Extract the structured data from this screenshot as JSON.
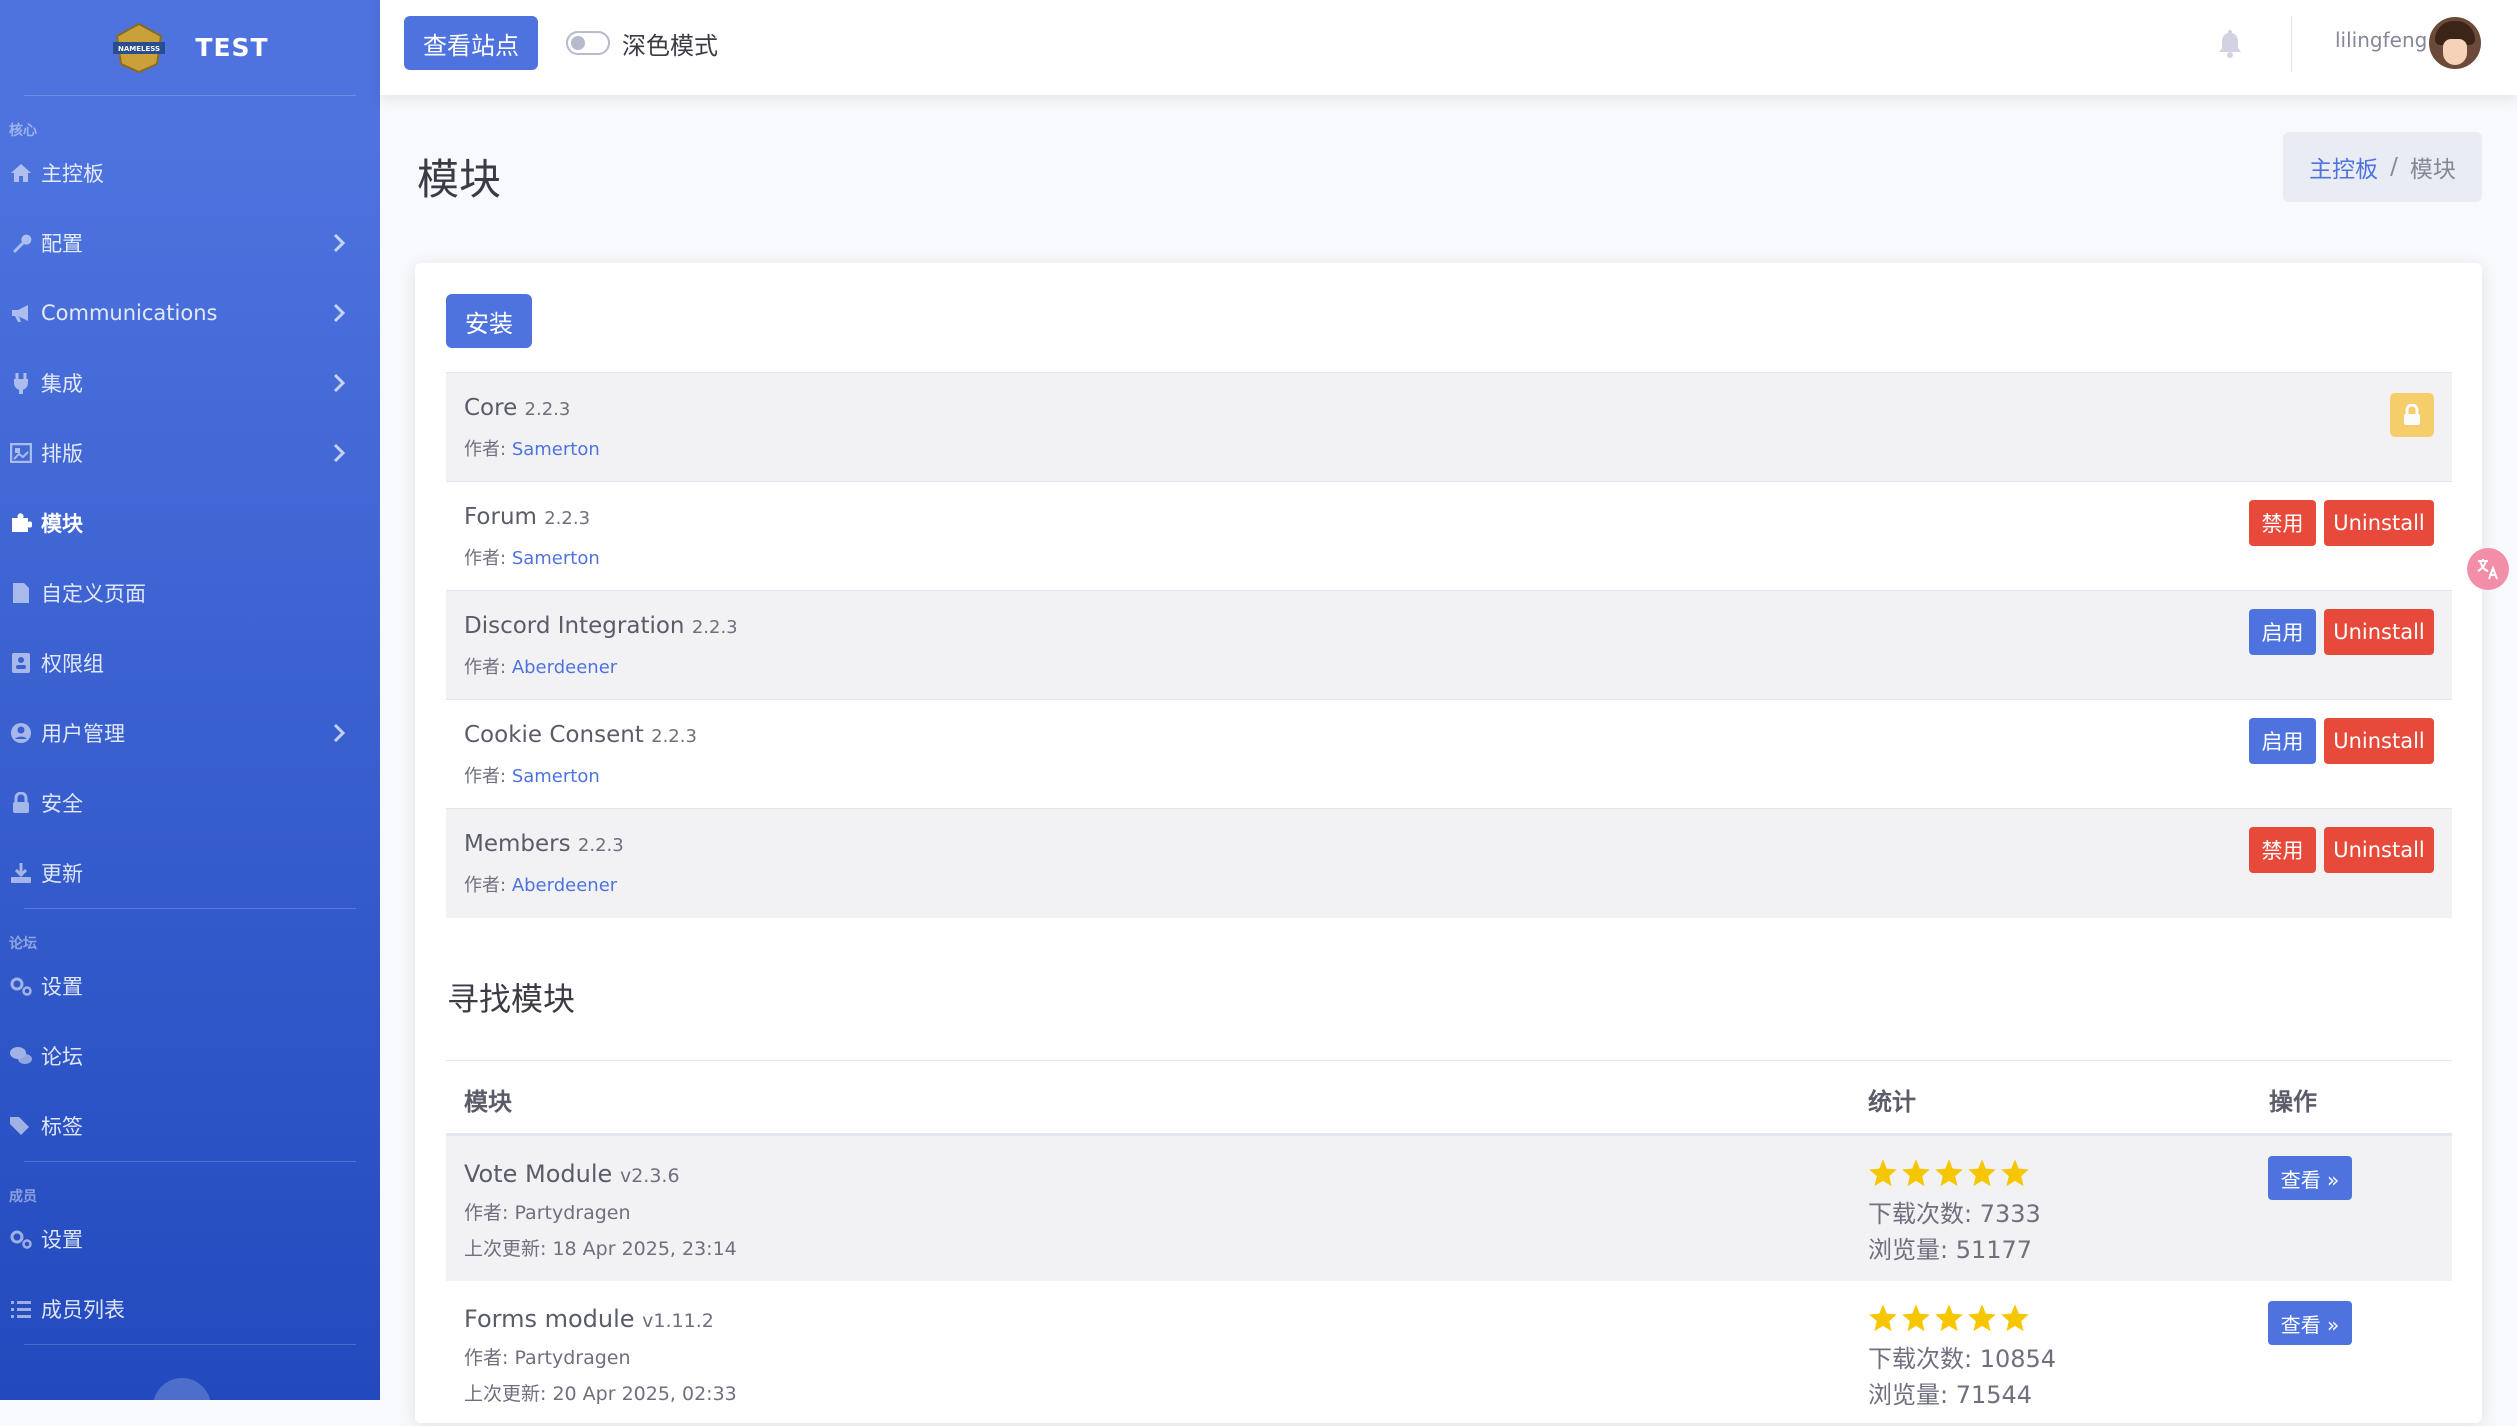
{
  "brand": {
    "title": "TEST",
    "logo_text": "NAMELESS"
  },
  "sidebar": {
    "heading_core": "核心",
    "heading_forum": "论坛",
    "heading_members": "成员",
    "items": [
      {
        "label": "主控板",
        "icon": "home-icon"
      },
      {
        "label": "配置",
        "icon": "wrench-icon"
      },
      {
        "label": "Communications",
        "icon": "megaphone-icon"
      },
      {
        "label": "集成",
        "icon": "plug-icon"
      },
      {
        "label": "排版",
        "icon": "layout-icon"
      },
      {
        "label": "模块",
        "icon": "puzzle-icon"
      },
      {
        "label": "自定义页面",
        "icon": "file-icon"
      },
      {
        "label": "权限组",
        "icon": "address-card-icon"
      },
      {
        "label": "用户管理",
        "icon": "user-circle-icon"
      },
      {
        "label": "安全",
        "icon": "lock-icon"
      },
      {
        "label": "更新",
        "icon": "download-icon"
      }
    ],
    "forum_items": [
      {
        "label": "设置",
        "icon": "cogs-icon"
      },
      {
        "label": "论坛",
        "icon": "comments-icon"
      },
      {
        "label": "标签",
        "icon": "tags-icon"
      }
    ],
    "member_items": [
      {
        "label": "设置",
        "icon": "cogs-icon"
      },
      {
        "label": "成员列表",
        "icon": "list-icon"
      }
    ]
  },
  "topbar": {
    "view_site": "查看站点",
    "dark_mode": "深色模式",
    "username": "lilingfeng"
  },
  "page": {
    "title": "模块",
    "breadcrumb_home": "主控板",
    "breadcrumb_sep": "/",
    "breadcrumb_current": "模块"
  },
  "installed": {
    "install_button": "安装",
    "author_prefix": "作者:",
    "uninstall": "Uninstall",
    "modules": [
      {
        "name": "Core",
        "version": "2.2.3",
        "author": "Samerton",
        "action": "locked"
      },
      {
        "name": "Forum",
        "version": "2.2.3",
        "author": "Samerton",
        "action": "禁用"
      },
      {
        "name": "Discord Integration",
        "version": "2.2.3",
        "author": "Aberdeener",
        "action": "启用"
      },
      {
        "name": "Cookie Consent",
        "version": "2.2.3",
        "author": "Samerton",
        "action": "启用"
      },
      {
        "name": "Members",
        "version": "2.2.3",
        "author": "Aberdeener",
        "action": "禁用"
      }
    ]
  },
  "find": {
    "title": "寻找模块",
    "columns": [
      "模块",
      "统计",
      "操作"
    ],
    "rows": [
      {
        "name": "Vote Module",
        "version": "v2.3.6",
        "author": "作者: Partydragen",
        "updated": "上次更新: 18 Apr 2025, 23:14",
        "rating": 5,
        "downloads": "下载次数: 7333",
        "views": "浏览量: 51177",
        "button": "查看 »"
      },
      {
        "name": "Forms module",
        "version": "v1.11.2",
        "author": "作者: Partydragen",
        "updated": "上次更新: 20 Apr 2025, 02:33",
        "rating": 5,
        "downloads": "下载次数: 10854",
        "views": "浏览量: 71544",
        "button": "查看 »"
      }
    ]
  },
  "colors": {
    "primary": "#4e73df",
    "danger": "#e74a3b",
    "warning": "#f6c23e",
    "star": "#f6c700"
  }
}
